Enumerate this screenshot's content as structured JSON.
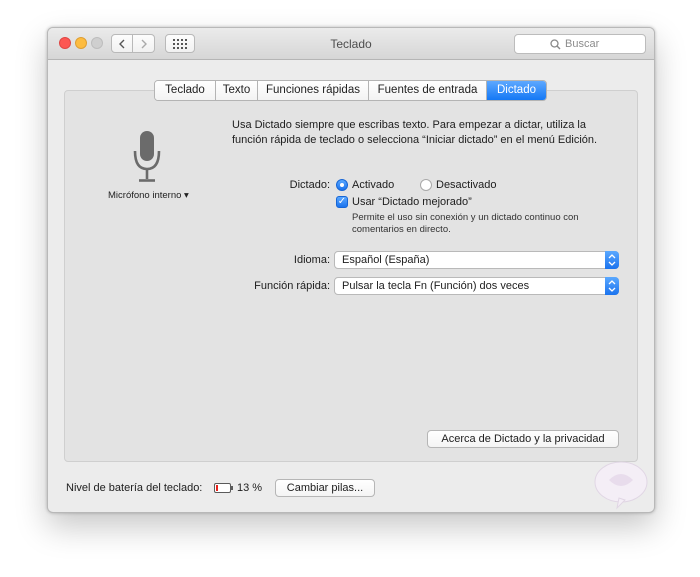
{
  "window": {
    "title": "Teclado"
  },
  "toolbar": {
    "search_placeholder": "Buscar"
  },
  "tabs": [
    {
      "label": "Teclado",
      "active": false
    },
    {
      "label": "Texto",
      "active": false
    },
    {
      "label": "Funciones rápidas",
      "active": false
    },
    {
      "label": "Fuentes de entrada",
      "active": false
    },
    {
      "label": "Dictado",
      "active": true
    }
  ],
  "microphone": {
    "label": "Micrófono interno ▾",
    "icon": "microphone-icon"
  },
  "intro_text": "Usa Dictado siempre que escribas texto. Para empezar a dictar, utiliza la función rápida de teclado o selecciona “Iniciar dictado” en el menú Edición.",
  "dictation": {
    "label": "Dictado:",
    "on_label": "Activado",
    "off_label": "Desactivado",
    "selected": "Activado",
    "enhanced_label": "Usar “Dictado mejorado”",
    "enhanced_checked": true,
    "enhanced_desc_line1": "Permite el uso sin conexión y un dictado continuo con",
    "enhanced_desc_line2": "comentarios en directo."
  },
  "language": {
    "label": "Idioma:",
    "value": "Español (España)"
  },
  "shortcut": {
    "label": "Función rápida:",
    "value": "Pulsar la tecla Fn (Función) dos veces"
  },
  "about_button": "Acerca de Dictado y la privacidad",
  "battery": {
    "label": "Nivel de batería del teclado:",
    "percent_text": "13 %",
    "level": 0.13,
    "color": "#e8231d"
  },
  "change_batteries_button": "Cambiar pilas...",
  "colors": {
    "accent": "#1478f5",
    "window_bg": "#ececec",
    "panel_bg": "#e3e3e3"
  }
}
